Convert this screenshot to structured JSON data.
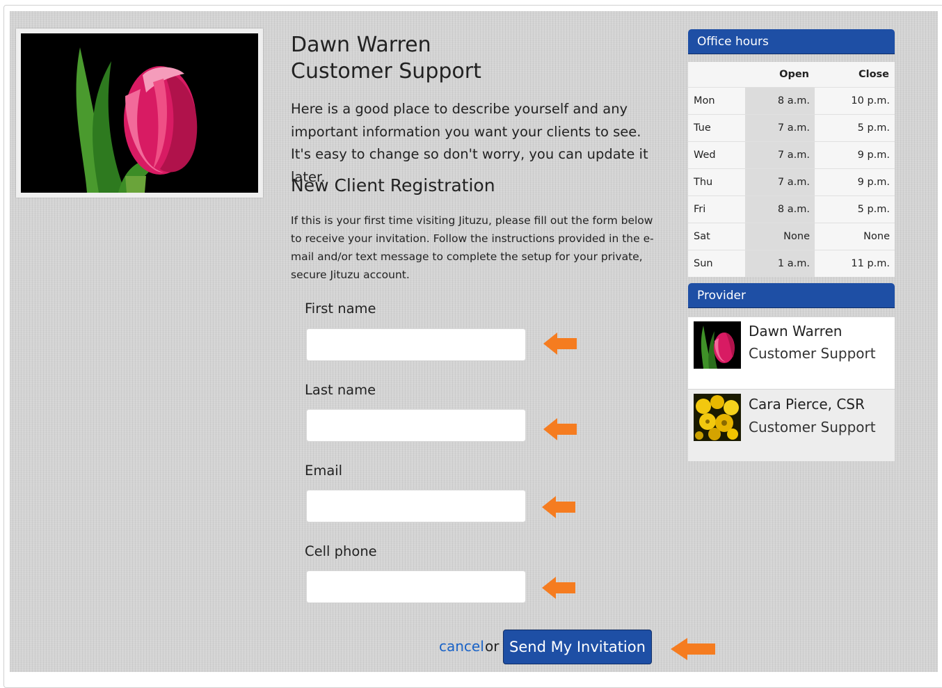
{
  "profile": {
    "name": "Dawn Warren",
    "title": "Customer Support",
    "intro": "Here is a good place to describe yourself and any important information you want your clients to see. It's easy to change so don't worry, you can update it later."
  },
  "registration": {
    "heading": "New Client Registration",
    "description": "If this is your first time visiting Jituzu, please fill out the form below to receive your invitation. Follow the instructions provided in the e-mail and/or text message to complete the setup for your private, secure Jituzu account.",
    "fields": {
      "first_name": {
        "label": "First name",
        "value": ""
      },
      "last_name": {
        "label": "Last name",
        "value": ""
      },
      "email": {
        "label": "Email",
        "value": ""
      },
      "cell_phone": {
        "label": "Cell phone",
        "value": ""
      }
    },
    "cancel_label": "cancel",
    "or_label": "or",
    "submit_label": "Send My Invitation"
  },
  "office_hours": {
    "heading": "Office hours",
    "columns": [
      "",
      "Open",
      "Close"
    ],
    "rows": [
      {
        "day": "Mon",
        "open": "8 a.m.",
        "close": "10 p.m."
      },
      {
        "day": "Tue",
        "open": "7 a.m.",
        "close": "5 p.m."
      },
      {
        "day": "Wed",
        "open": "7 a.m.",
        "close": "9 p.m."
      },
      {
        "day": "Thu",
        "open": "7 a.m.",
        "close": "9 p.m."
      },
      {
        "day": "Fri",
        "open": "8 a.m.",
        "close": "5 p.m."
      },
      {
        "day": "Sat",
        "open": "None",
        "close": "None"
      },
      {
        "day": "Sun",
        "open": "1 a.m.",
        "close": "11 p.m."
      }
    ]
  },
  "provider": {
    "heading": "Provider",
    "items": [
      {
        "name": "Dawn Warren",
        "role": "Customer Support",
        "photo": "pink-tulip"
      },
      {
        "name": "Cara Pierce, CSR",
        "role": "Customer Support",
        "photo": "yellow-flowers"
      }
    ]
  },
  "colors": {
    "header_blue": "#1e4fa5",
    "link_blue": "#1a63c7",
    "arrow_orange": "#f57c20",
    "panel_gray": "#d4d4d4"
  }
}
